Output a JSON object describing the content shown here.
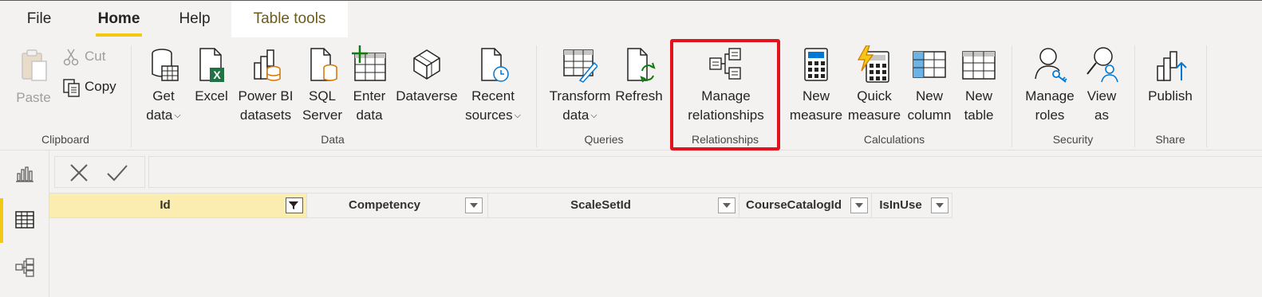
{
  "tabs": {
    "file": "File",
    "home": "Home",
    "help": "Help",
    "table_tools": "Table tools"
  },
  "clipboard": {
    "paste": "Paste",
    "cut": "Cut",
    "copy": "Copy",
    "group": "Clipboard"
  },
  "data_group": {
    "get_data_1": "Get",
    "get_data_2": "data",
    "excel": "Excel",
    "power_bi_1": "Power BI",
    "power_bi_2": "datasets",
    "sql_1": "SQL",
    "sql_2": "Server",
    "enter_1": "Enter",
    "enter_2": "data",
    "dataverse": "Dataverse",
    "recent_1": "Recent",
    "recent_2": "sources",
    "group": "Data"
  },
  "queries": {
    "transform_1": "Transform",
    "transform_2": "data",
    "refresh": "Refresh",
    "group": "Queries"
  },
  "relationships": {
    "manage_1": "Manage",
    "manage_2": "relationships",
    "group": "Relationships"
  },
  "calculations": {
    "new_measure_1": "New",
    "new_measure_2": "measure",
    "quick_measure_1": "Quick",
    "quick_measure_2": "measure",
    "new_column_1": "New",
    "new_column_2": "column",
    "new_table_1": "New",
    "new_table_2": "table",
    "group": "Calculations"
  },
  "security": {
    "manage_roles_1": "Manage",
    "manage_roles_2": "roles",
    "view_as_1": "View",
    "view_as_2": "as",
    "group": "Security"
  },
  "share": {
    "publish": "Publish",
    "group": "Share"
  },
  "table": {
    "columns": [
      "Id",
      "Competency",
      "ScaleSetId",
      "CourseCatalogId",
      "IsInUse"
    ]
  },
  "colors": {
    "accent": "#f2c811",
    "highlight_box": "#e3131b",
    "selected_column": "#fbedb0",
    "table_tools_text": "#6b5b1c"
  }
}
